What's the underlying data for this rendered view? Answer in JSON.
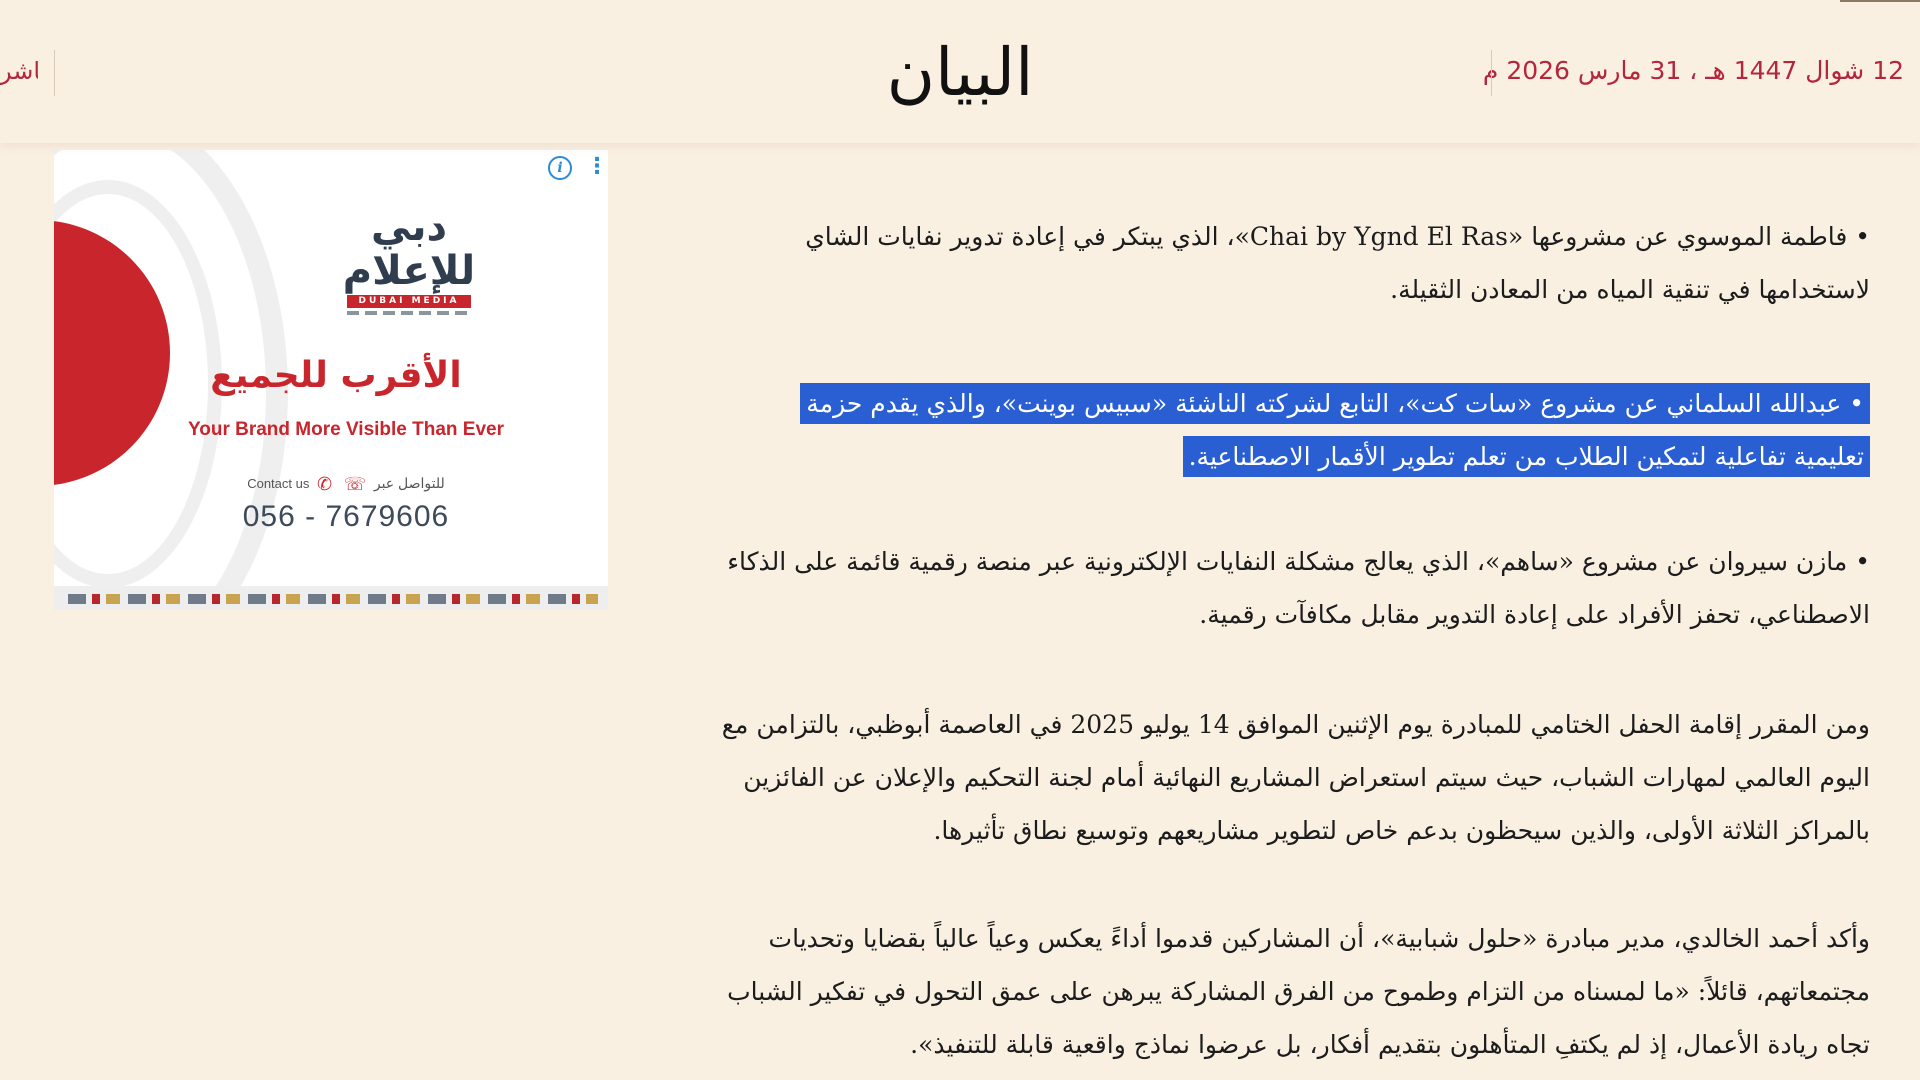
{
  "header": {
    "date": "12 شوال 1447 هـ ، 31 مارس 2026 م",
    "logo": "البيان",
    "left_link": "المباشر"
  },
  "ad": {
    "logo_text": "دبي للإعلام",
    "logo_band": "DUBAI MEDIA",
    "headline": "الأقرب للجميع",
    "subline": "Your Brand More Visible Than Ever",
    "contact_en": "Contact us",
    "contact_ar": "للتواصل عبر",
    "phone": "056 - 7679606",
    "info_icon": "info-icon",
    "menu_icon": "more-vertical-icon"
  },
  "article": {
    "paragraphs": [
      "• فاطمة الموسوي عن مشروعها «Chai by Ygnd El Ras»، الذي يبتكر في إعادة تدوير نفايات الشاي لاستخدامها في تنقية المياه من المعادن الثقيلة.",
      "• عبدالله السلماني عن مشروع «سات كت»، التابع لشركته الناشئة «سبيس بوينت»، والذي يقدم حزمة تعليمية تفاعلية لتمكين الطلاب من تعلم تطوير الأقمار الاصطناعية.",
      "• مازن سيروان عن مشروع «ساهم»، الذي يعالج مشكلة النفايات الإلكترونية عبر منصة رقمية قائمة على الذكاء الاصطناعي، تحفز الأفراد على إعادة التدوير مقابل مكافآت رقمية.",
      "ومن المقرر إقامة الحفل الختامي للمبادرة يوم الإثنين الموافق 14 يوليو 2025 في العاصمة أبوظبي، بالتزامن مع اليوم العالمي لمهارات الشباب، حيث سيتم استعراض المشاريع النهائية أمام لجنة التحكيم والإعلان عن الفائزين بالمراكز الثلاثة الأولى، والذين سيحظون بدعم خاص لتطوير مشاريعهم وتوسيع نطاق تأثيرها.",
      "وأكد أحمد الخالدي، مدير مبادرة «حلول شبابية»، أن المشاركين قدموا أداءً يعكس وعياً عالياً بقضايا وتحديات مجتمعاتهم، قائلاً: «ما لمسناه من التزام وطموح من الفرق المشاركة يبرهن على عمق التحول في تفكير الشباب تجاه ريادة الأعمال، إذ لم يكتفِ المتأهلون بتقديم أفكار، بل عرضوا نماذج واقعية قابلة للتنفيذ»."
    ],
    "highlighted_index": 1
  },
  "colors": {
    "background": "#faf0e2",
    "accent": "#b3263b",
    "selection": "#2a5fd4",
    "ad_red": "#c9252c"
  }
}
